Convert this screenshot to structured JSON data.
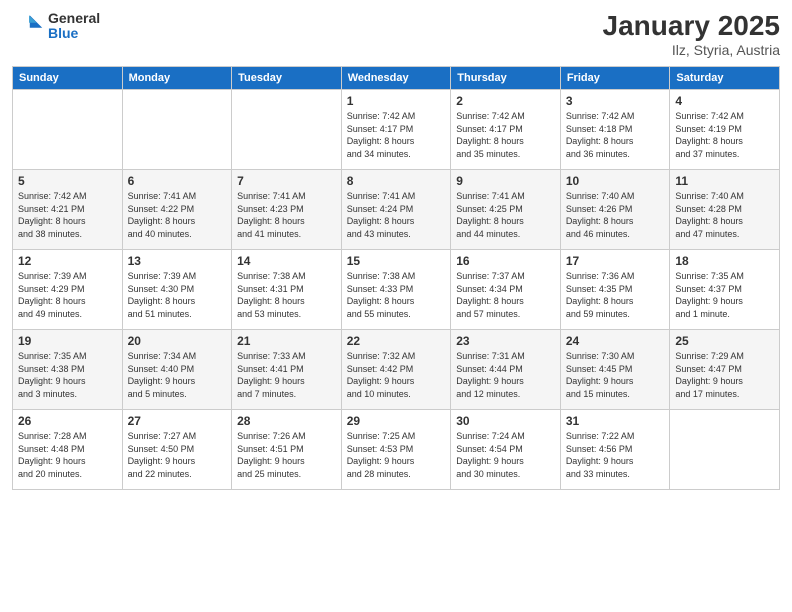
{
  "header": {
    "logo_general": "General",
    "logo_blue": "Blue",
    "month_title": "January 2025",
    "location": "Ilz, Styria, Austria"
  },
  "days_of_week": [
    "Sunday",
    "Monday",
    "Tuesday",
    "Wednesday",
    "Thursday",
    "Friday",
    "Saturday"
  ],
  "weeks": [
    {
      "shaded": false,
      "days": [
        {
          "number": "",
          "info": ""
        },
        {
          "number": "",
          "info": ""
        },
        {
          "number": "",
          "info": ""
        },
        {
          "number": "1",
          "info": "Sunrise: 7:42 AM\nSunset: 4:17 PM\nDaylight: 8 hours\nand 34 minutes."
        },
        {
          "number": "2",
          "info": "Sunrise: 7:42 AM\nSunset: 4:17 PM\nDaylight: 8 hours\nand 35 minutes."
        },
        {
          "number": "3",
          "info": "Sunrise: 7:42 AM\nSunset: 4:18 PM\nDaylight: 8 hours\nand 36 minutes."
        },
        {
          "number": "4",
          "info": "Sunrise: 7:42 AM\nSunset: 4:19 PM\nDaylight: 8 hours\nand 37 minutes."
        }
      ]
    },
    {
      "shaded": true,
      "days": [
        {
          "number": "5",
          "info": "Sunrise: 7:42 AM\nSunset: 4:21 PM\nDaylight: 8 hours\nand 38 minutes."
        },
        {
          "number": "6",
          "info": "Sunrise: 7:41 AM\nSunset: 4:22 PM\nDaylight: 8 hours\nand 40 minutes."
        },
        {
          "number": "7",
          "info": "Sunrise: 7:41 AM\nSunset: 4:23 PM\nDaylight: 8 hours\nand 41 minutes."
        },
        {
          "number": "8",
          "info": "Sunrise: 7:41 AM\nSunset: 4:24 PM\nDaylight: 8 hours\nand 43 minutes."
        },
        {
          "number": "9",
          "info": "Sunrise: 7:41 AM\nSunset: 4:25 PM\nDaylight: 8 hours\nand 44 minutes."
        },
        {
          "number": "10",
          "info": "Sunrise: 7:40 AM\nSunset: 4:26 PM\nDaylight: 8 hours\nand 46 minutes."
        },
        {
          "number": "11",
          "info": "Sunrise: 7:40 AM\nSunset: 4:28 PM\nDaylight: 8 hours\nand 47 minutes."
        }
      ]
    },
    {
      "shaded": false,
      "days": [
        {
          "number": "12",
          "info": "Sunrise: 7:39 AM\nSunset: 4:29 PM\nDaylight: 8 hours\nand 49 minutes."
        },
        {
          "number": "13",
          "info": "Sunrise: 7:39 AM\nSunset: 4:30 PM\nDaylight: 8 hours\nand 51 minutes."
        },
        {
          "number": "14",
          "info": "Sunrise: 7:38 AM\nSunset: 4:31 PM\nDaylight: 8 hours\nand 53 minutes."
        },
        {
          "number": "15",
          "info": "Sunrise: 7:38 AM\nSunset: 4:33 PM\nDaylight: 8 hours\nand 55 minutes."
        },
        {
          "number": "16",
          "info": "Sunrise: 7:37 AM\nSunset: 4:34 PM\nDaylight: 8 hours\nand 57 minutes."
        },
        {
          "number": "17",
          "info": "Sunrise: 7:36 AM\nSunset: 4:35 PM\nDaylight: 8 hours\nand 59 minutes."
        },
        {
          "number": "18",
          "info": "Sunrise: 7:35 AM\nSunset: 4:37 PM\nDaylight: 9 hours\nand 1 minute."
        }
      ]
    },
    {
      "shaded": true,
      "days": [
        {
          "number": "19",
          "info": "Sunrise: 7:35 AM\nSunset: 4:38 PM\nDaylight: 9 hours\nand 3 minutes."
        },
        {
          "number": "20",
          "info": "Sunrise: 7:34 AM\nSunset: 4:40 PM\nDaylight: 9 hours\nand 5 minutes."
        },
        {
          "number": "21",
          "info": "Sunrise: 7:33 AM\nSunset: 4:41 PM\nDaylight: 9 hours\nand 7 minutes."
        },
        {
          "number": "22",
          "info": "Sunrise: 7:32 AM\nSunset: 4:42 PM\nDaylight: 9 hours\nand 10 minutes."
        },
        {
          "number": "23",
          "info": "Sunrise: 7:31 AM\nSunset: 4:44 PM\nDaylight: 9 hours\nand 12 minutes."
        },
        {
          "number": "24",
          "info": "Sunrise: 7:30 AM\nSunset: 4:45 PM\nDaylight: 9 hours\nand 15 minutes."
        },
        {
          "number": "25",
          "info": "Sunrise: 7:29 AM\nSunset: 4:47 PM\nDaylight: 9 hours\nand 17 minutes."
        }
      ]
    },
    {
      "shaded": false,
      "days": [
        {
          "number": "26",
          "info": "Sunrise: 7:28 AM\nSunset: 4:48 PM\nDaylight: 9 hours\nand 20 minutes."
        },
        {
          "number": "27",
          "info": "Sunrise: 7:27 AM\nSunset: 4:50 PM\nDaylight: 9 hours\nand 22 minutes."
        },
        {
          "number": "28",
          "info": "Sunrise: 7:26 AM\nSunset: 4:51 PM\nDaylight: 9 hours\nand 25 minutes."
        },
        {
          "number": "29",
          "info": "Sunrise: 7:25 AM\nSunset: 4:53 PM\nDaylight: 9 hours\nand 28 minutes."
        },
        {
          "number": "30",
          "info": "Sunrise: 7:24 AM\nSunset: 4:54 PM\nDaylight: 9 hours\nand 30 minutes."
        },
        {
          "number": "31",
          "info": "Sunrise: 7:22 AM\nSunset: 4:56 PM\nDaylight: 9 hours\nand 33 minutes."
        },
        {
          "number": "",
          "info": ""
        }
      ]
    }
  ]
}
